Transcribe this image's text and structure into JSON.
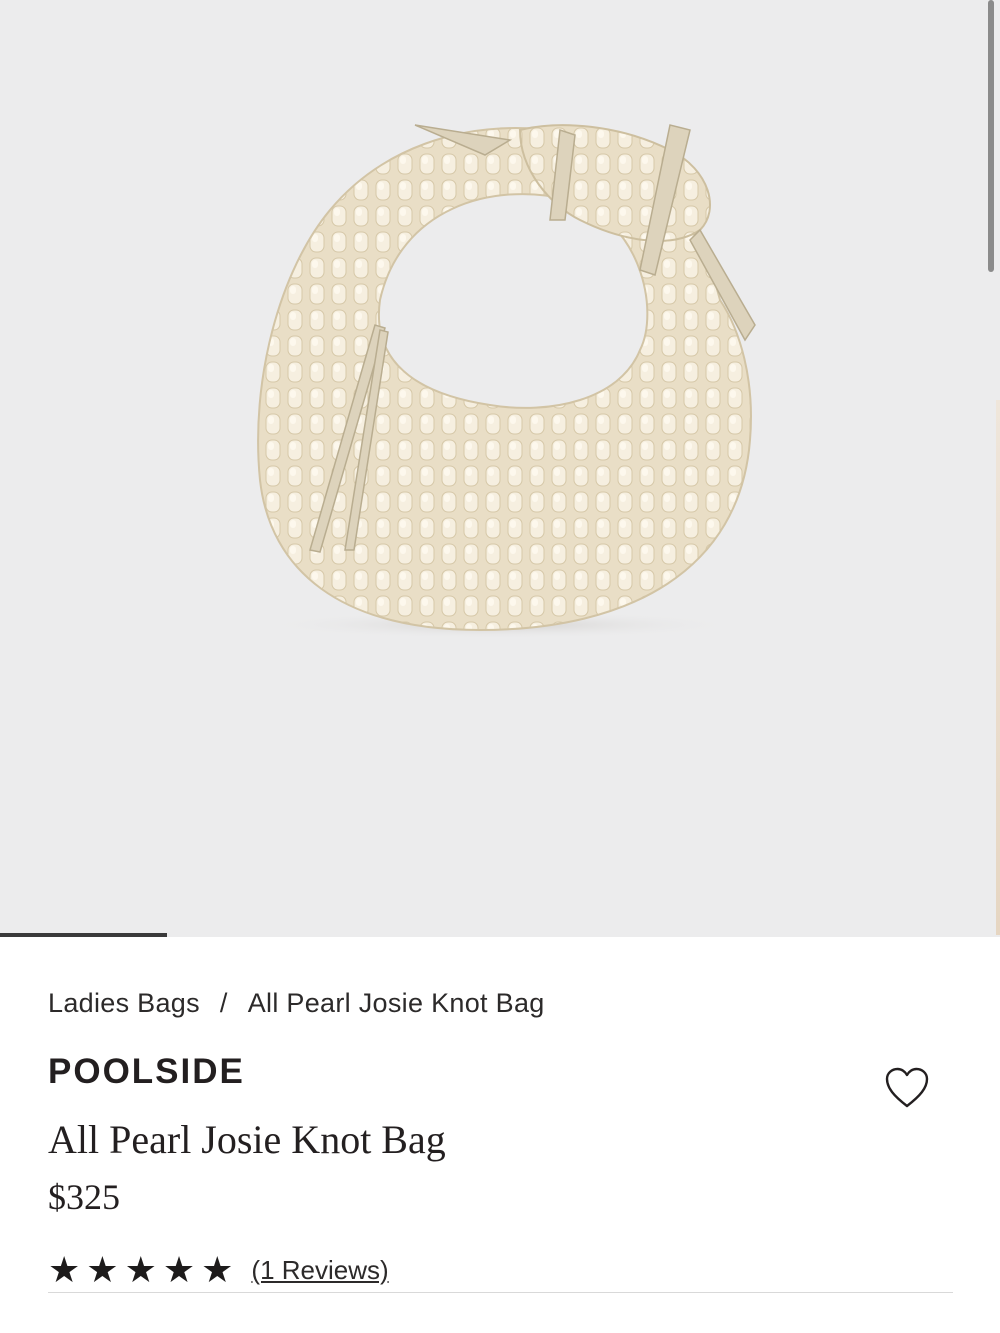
{
  "hero": {
    "image_alt": "All Pearl Josie Knot Bag product image",
    "carousel_progress": 0.167,
    "colors": {
      "background": "#ececed",
      "pearl": "#f1e8d4",
      "ribbon": "#d9cfb8"
    }
  },
  "breadcrumb": {
    "items": [
      "Ladies Bags",
      "All Pearl Josie Knot Bag"
    ],
    "separator": "/"
  },
  "product": {
    "brand": "POOLSIDE",
    "name": "All Pearl Josie Knot Bag",
    "price": "$325",
    "rating": 5,
    "rating_max": 5,
    "reviews_label": "(1 Reviews)",
    "wishlist_icon": "heart-outline-icon"
  }
}
